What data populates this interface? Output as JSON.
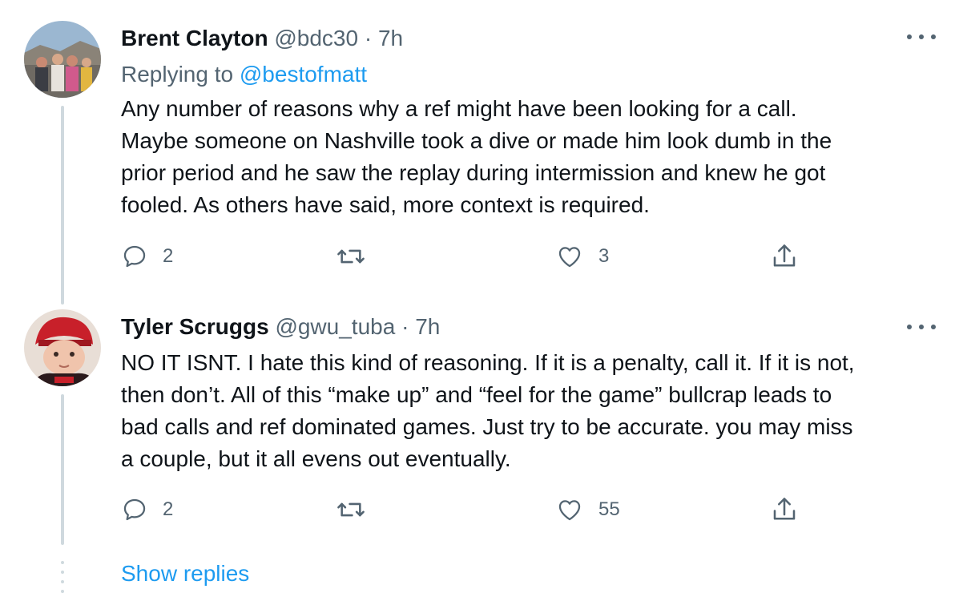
{
  "tweets": [
    {
      "name": "Brent Clayton",
      "handle": "@bdc30",
      "time": "7h",
      "replying_label": "Replying to",
      "replying_to": "@bestofmatt",
      "body_lines": [
        "Any number of reasons why a ref might have been looking for a call.",
        "Maybe someone on Nashville took a dive or made him look dumb in the",
        "prior period and he saw the replay during intermission and knew he got",
        "fooled.  As others have said, more context is required."
      ],
      "replies": "2",
      "retweets": "",
      "likes": "3",
      "avatar_colors": {
        "sky": "#9bb7d1",
        "ground": "#6f6a63",
        "people": "#c98a73"
      }
    },
    {
      "name": "Tyler Scruggs",
      "handle": "@gwu_tuba",
      "time": "7h",
      "body_lines": [
        "NO IT ISNT. I hate this kind of reasoning. If it is a penalty, call it. If it is not,",
        "then don’t. All of this “make up” and “feel for the game” bullcrap leads to",
        "bad calls and ref dominated games. Just try to be accurate. you may miss",
        "a couple, but it all evens out eventually."
      ],
      "replies": "2",
      "retweets": "",
      "likes": "55",
      "avatar_colors": {
        "bg": "#e8ded6",
        "hat": "#c8202a",
        "shirt": "#2b1a1c"
      }
    }
  ],
  "separator": " · ",
  "show_replies": "Show replies",
  "colors": {
    "text": "#0f1419",
    "secondary": "#536471",
    "link": "#1d9bf0",
    "thread_line": "#cfd9de"
  }
}
